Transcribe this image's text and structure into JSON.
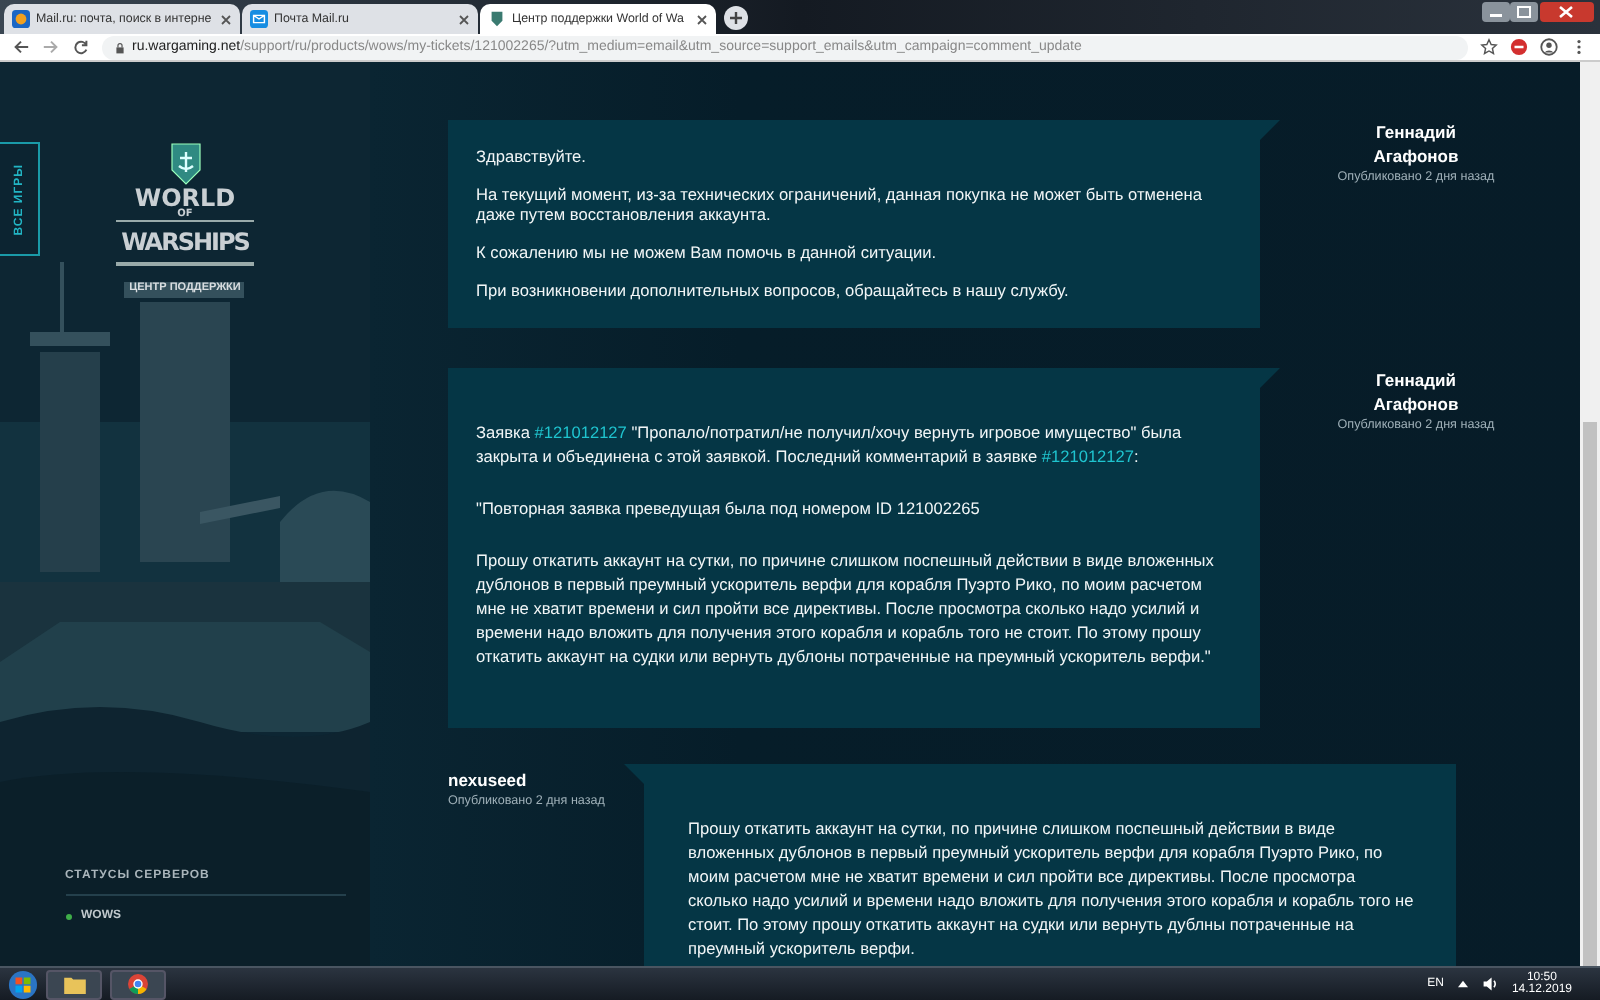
{
  "browser": {
    "tabs": [
      {
        "title": "Mail.ru: почта, поиск в интерне",
        "kind": "mail",
        "selected": false
      },
      {
        "title": "Почта Mail.ru",
        "kind": "mailbox",
        "selected": false
      },
      {
        "title": "Центр поддержки World of Wa",
        "kind": "shield",
        "selected": true
      }
    ],
    "address": {
      "host": "ru.wargaming.net",
      "path": "/support/ru/products/wows/my-tickets/121002265/?utm_medium=email&utm_source=support_emails&utm_campaign=comment_update"
    }
  },
  "sidebar": {
    "all_games_tab": "ВСЕ ИГРЫ",
    "logo": {
      "line1": "WORLD",
      "line2": "OF",
      "line3": "WARSHIPS"
    },
    "subtitle": "ЦЕНТР ПОДДЕРЖКИ",
    "servers_title": "СТАТУСЫ СЕРВЕРОВ",
    "servers": [
      {
        "name": "WOWS",
        "color": "#3fae49"
      }
    ]
  },
  "comments": [
    {
      "author": "Геннадий Агафонов",
      "published": "Опубликовано 2 дня назад",
      "kind": "staff",
      "paragraphs": [
        [
          {
            "text": "Здравствуйте."
          }
        ],
        [
          {
            "text": "На текущий момент, из-за технических ограничений, данная покупка не может быть отменена даже путем восстановления аккаунта."
          }
        ],
        [
          {
            "text": "К сожалению мы не можем Вам помочь в данной ситуации."
          }
        ],
        [
          {
            "text": "При возникновении дополнительных вопросов, обращайтесь в нашу службу."
          }
        ]
      ]
    },
    {
      "author": "Геннадий Агафонов",
      "published": "Опубликовано 2 дня назад",
      "kind": "staff",
      "paragraphs": [
        [
          {
            "text": "Заявка "
          },
          {
            "link": "#121012127"
          },
          {
            "text": " \"Пропало/потратил/не получил/хочу вернуть игровое имущество\" была закрыта и объединена с этой заявкой. Последний комментарий в заявке "
          },
          {
            "link": "#121012127"
          },
          {
            "text": ":"
          }
        ],
        [
          {
            "text": "\"Повторная заявка преведущая была под номером ID 121002265"
          }
        ],
        [
          {
            "text": "Прошу откатить аккаунт на сутки, по причине слишком поспешный действии в виде вложенных дублонов в первый преумный ускоритель верфи для корабля Пуэрто Рико, по моим расчетом мне не хватит времени и сил пройти все директивы. После просмотра сколько надо усилий и времени надо вложить для получения этого корабля и корабль того не стоит. По этому прошу откатить аккаунт на судки или вернуть дублоны потраченные на преумный ускоритель верфи.\""
          }
        ]
      ]
    },
    {
      "author": "nexuseed",
      "published": "Опубликовано 2 дня назад",
      "kind": "user",
      "paragraphs": [
        [
          {
            "text": "Прошу откатить аккаунт на сутки, по причине слишком поспешный действии в виде вложенных дублонов в первый преумный ускоритель верфи для корабля Пуэрто Рико, по моим расчетом мне не хватит времени и сил пройти все директивы. После просмотра сколько надо усилий и времени надо вложить для получения этого корабля и корабль того не стоит. По этому прошу откатить аккаунт на судки или вернуть дублны потраченные на преумный ускоритель верфи."
          }
        ]
      ]
    }
  ],
  "taskbar": {
    "language": "EN",
    "time": "10:50",
    "date": "14.12.2019"
  }
}
